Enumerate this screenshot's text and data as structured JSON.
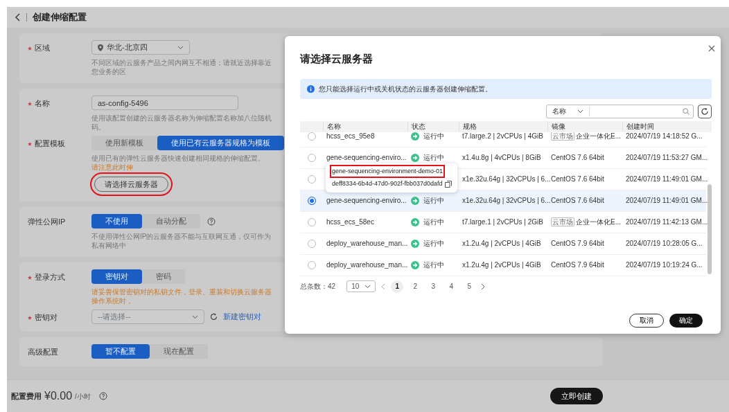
{
  "header": {
    "title": "创建伸缩配置"
  },
  "region": {
    "label": "区域",
    "required": true,
    "value": "华北-北京四",
    "hint": "不同区域的云服务产品之间内网互不相通；请就近选择靠近您业务的区"
  },
  "name": {
    "label": "名称",
    "required": true,
    "value": "as-config-5496",
    "hint": "使用该配置创建的云服务器名称为伸缩配置名称加八位随机码。"
  },
  "template": {
    "label": "配置模板",
    "required": true,
    "options": [
      {
        "label": "使用新模板",
        "selected": false
      },
      {
        "label": "使用已有云服务器规格为模板",
        "selected": true
      }
    ],
    "hint": "使用已有的弹性云服务器快速创建相同规格的伸缩配置。",
    "warning": "请注意此时伸",
    "button": {
      "label": "请选择云服务器",
      "highlighted": true
    }
  },
  "eip": {
    "label": "弹性公网IP",
    "required": false,
    "options": [
      {
        "label": "不使用",
        "selected": true
      },
      {
        "label": "自动分配",
        "selected": false
      }
    ],
    "hint": "不使用弹性公网IP的云服务器不能与互联网互通，仅可作为私有网络中"
  },
  "login": {
    "label": "登录方式",
    "required": true,
    "options": [
      {
        "label": "密钥对",
        "selected": true
      },
      {
        "label": "密码",
        "selected": false
      }
    ],
    "warning": "请妥善保管密钥对的私钥文件，登录、重装和切换云服务器操作系统时，"
  },
  "keypair": {
    "label": "密钥对",
    "required": true,
    "placeholder": "--请选择--",
    "link": "新建密钥对"
  },
  "advanced": {
    "label": "高级配置",
    "required": false,
    "options": [
      {
        "label": "暂不配置",
        "selected": true
      },
      {
        "label": "现在配置",
        "selected": false
      }
    ]
  },
  "footer": {
    "label": "配置费用",
    "price": "¥0.00",
    "unit": "/小时",
    "button": "立即创建"
  },
  "dialog": {
    "title": "请选择云服务器",
    "info": "您只能选择运行中或关机状态的云服务器创建伸缩配置。",
    "search": {
      "filter": "名称"
    },
    "columns": [
      "名称",
      "状态",
      "规格",
      "镜像",
      "创建时间"
    ],
    "rows": [
      {
        "selected": false,
        "name": "hcss_ecs_95e8",
        "status": "运行中",
        "spec": "t7.large.2 | 2vCPUs | 4GiB",
        "image_tag": "云市场",
        "image": "企业一体化E...",
        "created": "2024/07/19 14:18:52 G..."
      },
      {
        "selected": false,
        "name": "gene-sequencing-enviro...",
        "status": "运行中",
        "spec": "x1.4u.8g | 4vCPUs | 8GiB",
        "image": "CentOS 7.6 64bit",
        "created": "2024/07/19 11:53:27 GM..."
      },
      {
        "selected": false,
        "spec": "x1e.32u.64g | 32vCPUs | 6...",
        "image": "CentOS 7.6 64bit",
        "created": "2024/07/19 11:49:01 GM..."
      },
      {
        "selected": true,
        "name": "gene-sequencing-enviro...",
        "status": "运行中",
        "spec": "x1e.32u.64g | 32vCPUs | 6...",
        "image": "CentOS 7.6 64bit",
        "created": "2024/07/19 11:49:01 GM..."
      },
      {
        "selected": false,
        "name": "hcss_ecs_58ec",
        "status": "运行中",
        "spec": "t7.large.1 | 2vCPUs | 2GiB",
        "image_tag": "云市场",
        "image": "企业一体化E...",
        "created": "2024/07/19 11:42:13 GM..."
      },
      {
        "selected": false,
        "name": "deploy_warehouse_man...",
        "status": "运行中",
        "spec": "x1.2u.4g | 2vCPUs | 4GiB",
        "image": "CentOS 7.9 64bit",
        "created": "2024/07/19 10:28:05 G..."
      },
      {
        "selected": false,
        "name": "deploy_warehouse_man...",
        "status": "运行中",
        "spec": "x1.2u.4g | 2vCPUs | 4GiB",
        "image": "CentOS 7.9 64bit",
        "created": "2024/07/19 10:19:24 G..."
      }
    ],
    "tooltip": {
      "title": "gene-sequencing-environment-demo-01",
      "highlighted": true,
      "id": "deff8334-6b4d-47d0-902f-fbb037d0dafd"
    },
    "pagination": {
      "total": "总条数：42",
      "page_size": "10",
      "pages": [
        {
          "label": "1",
          "selected": true
        },
        {
          "label": "2",
          "selected": false
        },
        {
          "label": "3",
          "selected": false
        },
        {
          "label": "4",
          "selected": false
        },
        {
          "label": "5",
          "selected": false
        }
      ]
    },
    "buttons": {
      "cancel": "取消",
      "confirm": "确定"
    }
  }
}
